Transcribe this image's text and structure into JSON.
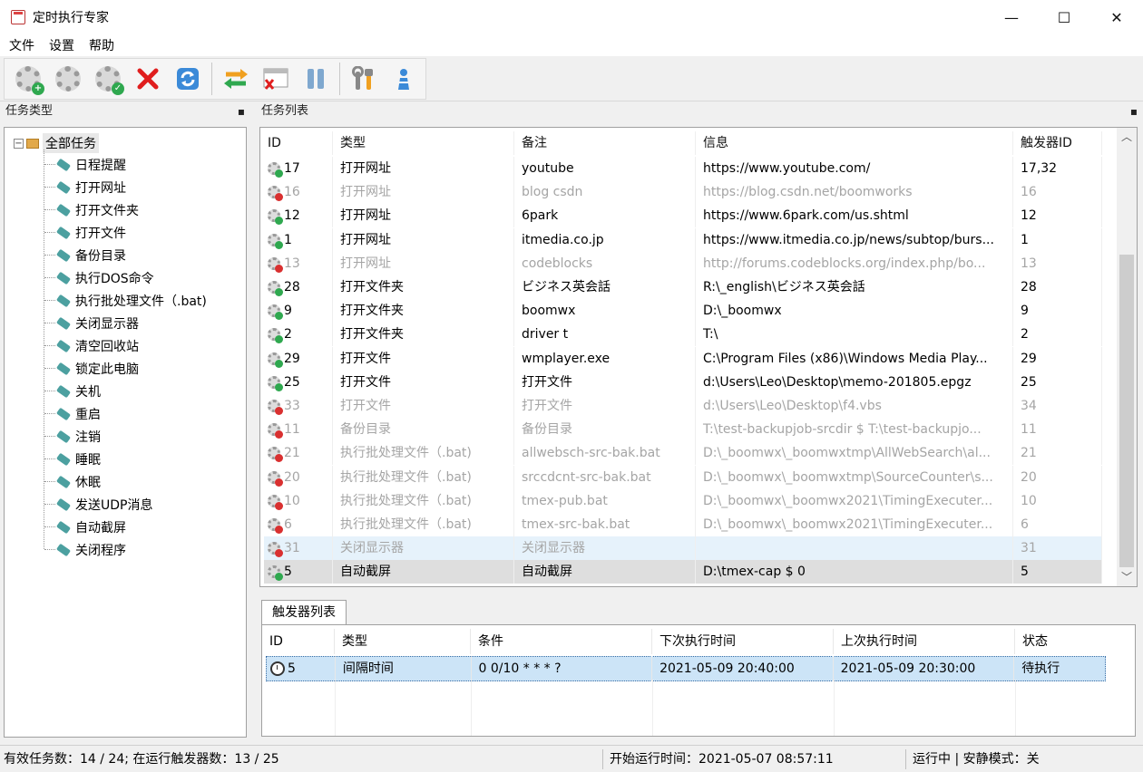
{
  "window": {
    "title": "定时执行专家",
    "minimize": "—",
    "maximize": "☐",
    "close": "✕"
  },
  "menu": [
    "文件",
    "设置",
    "帮助"
  ],
  "toolbar": {
    "icons": [
      "add-task-icon",
      "gear-icon",
      "enable-task-icon",
      "delete-icon",
      "refresh-icon",
      "switch-icon",
      "close-window-icon",
      "pause-icon",
      "tools-icon",
      "person-icon"
    ]
  },
  "task_types_panel": {
    "title": "任务类型",
    "pin": "📌",
    "root": "全部任务",
    "items": [
      "日程提醒",
      "打开网址",
      "打开文件夹",
      "打开文件",
      "备份目录",
      "执行DOS命令",
      "执行批处理文件（.bat)",
      "关闭显示器",
      "清空回收站",
      "锁定此电脑",
      "关机",
      "重启",
      "注销",
      "睡眠",
      "休眠",
      "发送UDP消息",
      "自动截屏",
      "关闭程序"
    ]
  },
  "task_list_panel": {
    "title": "任务列表",
    "pin": "📌",
    "columns": [
      "ID",
      "类型",
      "备注",
      "信息",
      "触发器ID"
    ],
    "rows": [
      {
        "id": "17",
        "type": "打开网址",
        "note": "youtube",
        "info": "https://www.youtube.com/",
        "trig": "17,32",
        "status": "ok"
      },
      {
        "id": "16",
        "type": "打开网址",
        "note": "blog csdn",
        "info": "https://blog.csdn.net/boomworks",
        "trig": "16",
        "status": "err"
      },
      {
        "id": "12",
        "type": "打开网址",
        "note": "6park",
        "info": "https://www.6park.com/us.shtml",
        "trig": "12",
        "status": "ok"
      },
      {
        "id": "1",
        "type": "打开网址",
        "note": "itmedia.co.jp",
        "info": "https://www.itmedia.co.jp/news/subtop/burs...",
        "trig": "1",
        "status": "ok"
      },
      {
        "id": "13",
        "type": "打开网址",
        "note": "codeblocks",
        "info": "http://forums.codeblocks.org/index.php/bo...",
        "trig": "13",
        "status": "err"
      },
      {
        "id": "28",
        "type": "打开文件夹",
        "note": "ビジネス英会話",
        "info": "R:\\_english\\ビジネス英会話",
        "trig": "28",
        "status": "ok"
      },
      {
        "id": "9",
        "type": "打开文件夹",
        "note": "boomwx",
        "info": "D:\\_boomwx",
        "trig": "9",
        "status": "ok"
      },
      {
        "id": "2",
        "type": "打开文件夹",
        "note": "driver t",
        "info": "T:\\",
        "trig": "2",
        "status": "ok"
      },
      {
        "id": "29",
        "type": "打开文件",
        "note": "wmplayer.exe",
        "info": "C:\\Program Files (x86)\\Windows Media Play...",
        "trig": "29",
        "status": "ok"
      },
      {
        "id": "25",
        "type": "打开文件",
        "note": "打开文件",
        "info": "d:\\Users\\Leo\\Desktop\\memo-201805.epgz",
        "trig": "25",
        "status": "ok"
      },
      {
        "id": "33",
        "type": "打开文件",
        "note": "打开文件",
        "info": "d:\\Users\\Leo\\Desktop\\f4.vbs",
        "trig": "34",
        "status": "err"
      },
      {
        "id": "11",
        "type": "备份目录",
        "note": "备份目录",
        "info": "T:\\test-backupjob-srcdir $ T:\\test-backupjo...",
        "trig": "11",
        "status": "err"
      },
      {
        "id": "21",
        "type": "执行批处理文件（.bat)",
        "note": "allwebsch-src-bak.bat",
        "info": "D:\\_boomwx\\_boomwxtmp\\AllWebSearch\\al...",
        "trig": "21",
        "status": "err"
      },
      {
        "id": "20",
        "type": "执行批处理文件（.bat)",
        "note": "srccdcnt-src-bak.bat",
        "info": "D:\\_boomwx\\_boomwxtmp\\SourceCounter\\s...",
        "trig": "20",
        "status": "err"
      },
      {
        "id": "10",
        "type": "执行批处理文件（.bat)",
        "note": "tmex-pub.bat",
        "info": "D:\\_boomwx\\_boomwx2021\\TimingExecuter...",
        "trig": "10",
        "status": "err"
      },
      {
        "id": "6",
        "type": "执行批处理文件（.bat)",
        "note": "tmex-src-bak.bat",
        "info": "D:\\_boomwx\\_boomwx2021\\TimingExecuter...",
        "trig": "6",
        "status": "err"
      },
      {
        "id": "31",
        "type": "关闭显示器",
        "note": "关闭显示器",
        "info": "",
        "trig": "31",
        "status": "err"
      },
      {
        "id": "5",
        "type": "自动截屏",
        "note": "自动截屏",
        "info": "D:\\tmex-cap $ 0",
        "trig": "5",
        "status": "ok"
      }
    ]
  },
  "trigger_panel": {
    "tab": "触发器列表",
    "columns": [
      "ID",
      "类型",
      "条件",
      "下次执行时间",
      "上次执行时间",
      "状态"
    ],
    "rows": [
      {
        "id": "5",
        "type": "间隔时间",
        "cond": "0 0/10 * * * ?",
        "next": "2021-05-09 20:40:00",
        "last": "2021-05-09 20:30:00",
        "state": "待执行"
      }
    ]
  },
  "statusbar": {
    "left": "有效任务数：14 / 24;  在运行触发器数：13 / 25",
    "middle": "开始运行时间：2021-05-07 08:57:11",
    "right": "运行中 | 安静模式：关"
  },
  "colors": {
    "selected_row": "#cce4f7",
    "hover_row": "#e6f2fb",
    "disabled_text": "#a5a5a5",
    "ok_badge": "#2fa84f",
    "err_badge": "#d93030"
  }
}
